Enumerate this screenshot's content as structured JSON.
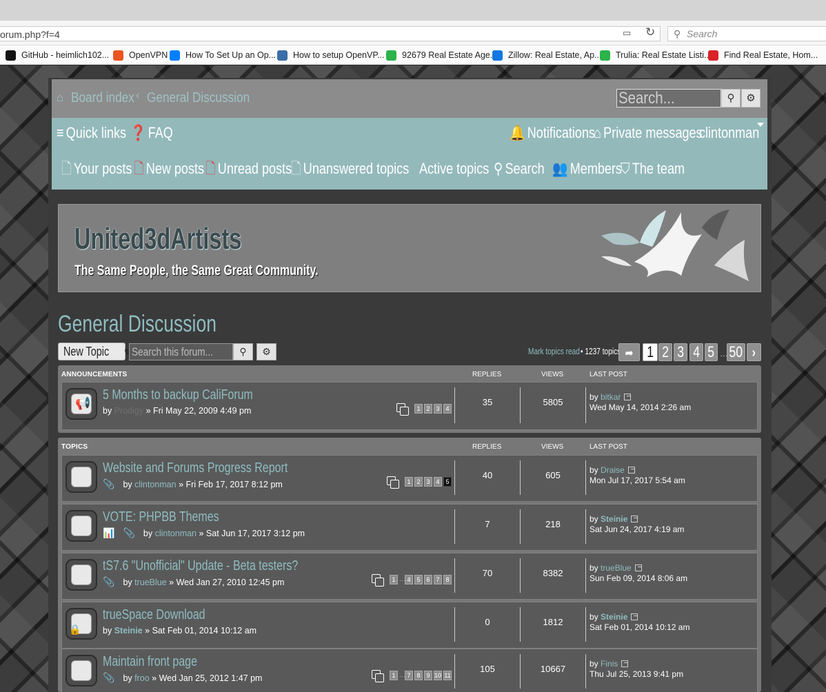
{
  "browser": {
    "url": "orum.php?f=4",
    "search_placeholder": "Search",
    "bookmarks": [
      {
        "label": "GitHub - heimlich102...",
        "icon": "github-icon",
        "color": "#111111"
      },
      {
        "label": "OpenVPN",
        "icon": "ubuntu-icon",
        "color": "#e95420"
      },
      {
        "label": "How To Set Up an Op...",
        "icon": "digitalocean-icon",
        "color": "#0080ff"
      },
      {
        "label": "How to setup OpenVP...",
        "icon": "x-icon",
        "color": "#3b6ea8"
      },
      {
        "label": "92679 Real Estate Age...",
        "icon": "trulia-icon",
        "color": "#2cb34a"
      },
      {
        "label": "Zillow: Real Estate, Ap...",
        "icon": "zillow-icon",
        "color": "#1277e1"
      },
      {
        "label": "Trulia: Real Estate Listi...",
        "icon": "trulia-icon",
        "color": "#2cb34a"
      },
      {
        "label": "Find Real Estate, Hom...",
        "icon": "realtor-icon",
        "color": "#d92228"
      }
    ]
  },
  "nav": {
    "board_index": "Board index",
    "general_discussion": "General Discussion",
    "search_placeholder": "Search...",
    "quick_links": "Quick links",
    "faq": "FAQ",
    "notifications": "Notifications",
    "private_messages": "Private messages",
    "username": "clintonman",
    "your_posts": "Your posts",
    "new_posts": "New posts",
    "unread_posts": "Unread posts",
    "unanswered": "Unanswered topics",
    "active": "Active topics",
    "search": "Search",
    "members": "Members",
    "team": "The team"
  },
  "site": {
    "title": "United3dArtists",
    "description": "The Same People, the Same Great Community."
  },
  "forum": {
    "title": "General Discussion",
    "new_topic": "New Topic",
    "search_forum_placeholder": "Search this forum...",
    "mark_read": "Mark topics read",
    "topic_count": "• 1237 topics",
    "pagination": [
      "1",
      "2",
      "3",
      "4",
      "5",
      "50"
    ],
    "current_page": "1",
    "dots": "…"
  },
  "announcements": {
    "header": "ANNOUNCEMENTS",
    "replies_header": "REPLIES",
    "views_header": "VIEWS",
    "lastpost_header": "LAST POST",
    "rows": [
      {
        "title": "5 Months to backup CaliForum",
        "by": "by",
        "author": "Prodigy",
        "date": "» Fri May 22, 2009 4:49 pm",
        "pages": [
          "1",
          "2",
          "3",
          "4"
        ],
        "replies": "35",
        "views": "5805",
        "last_by": "by",
        "last_author": "bitkar",
        "last_date": "Wed May 14, 2014 2:26 am"
      }
    ]
  },
  "topics": {
    "header": "TOPICS",
    "replies_header": "REPLIES",
    "views_header": "VIEWS",
    "lastpost_header": "LAST POST",
    "rows": [
      {
        "title": "Website and Forums Progress Report",
        "by": "by",
        "author": "clintonman",
        "date": "» Fri Feb 17, 2017 8:12 pm",
        "pages": [
          "1",
          "2",
          "3",
          "4",
          "5"
        ],
        "replies": "40",
        "views": "605",
        "last_by": "by",
        "last_author": "Draise",
        "last_date": "Mon Jul 17, 2017 5:54 am"
      },
      {
        "title": "VOTE: PHPBB Themes",
        "by": "by",
        "author": "clintonman",
        "date": "» Sat Jun 17, 2017 3:12 pm",
        "pages": [],
        "replies": "7",
        "views": "218",
        "last_by": "by",
        "last_author": "Steinie",
        "last_date": "Sat Jun 24, 2017 4:19 am"
      },
      {
        "title": "tS7.6 \"Unofficial\" Update - Beta testers?",
        "by": "by",
        "author": "trueBlue",
        "date": "» Wed Jan 27, 2010 12:45 pm",
        "pages": [
          "1",
          "…",
          "4",
          "5",
          "6",
          "7",
          "8"
        ],
        "replies": "70",
        "views": "8382",
        "last_by": "by",
        "last_author": "trueBlue",
        "last_date": "Sun Feb 09, 2014 8:06 am"
      },
      {
        "title": "trueSpace Download",
        "by": "by",
        "author": "Steinie",
        "date": "» Sat Feb 01, 2014 10:12 am",
        "pages": [],
        "replies": "0",
        "views": "1812",
        "last_by": "by",
        "last_author": "Steinie",
        "last_date": "Sat Feb 01, 2014 10:12 am"
      },
      {
        "title": "Maintain front page",
        "by": "by",
        "author": "froo",
        "date": "» Wed Jan 25, 2012 1:47 pm",
        "pages": [
          "1",
          "…",
          "7",
          "8",
          "9",
          "10",
          "11"
        ],
        "replies": "105",
        "views": "10667",
        "last_by": "by",
        "last_author": "Finis",
        "last_date": "Thu Jul 25, 2013 9:41 pm"
      }
    ]
  },
  "colors": {
    "accent": "#8fbcc0",
    "navbar": "#94b9bb",
    "row": "#595959"
  }
}
